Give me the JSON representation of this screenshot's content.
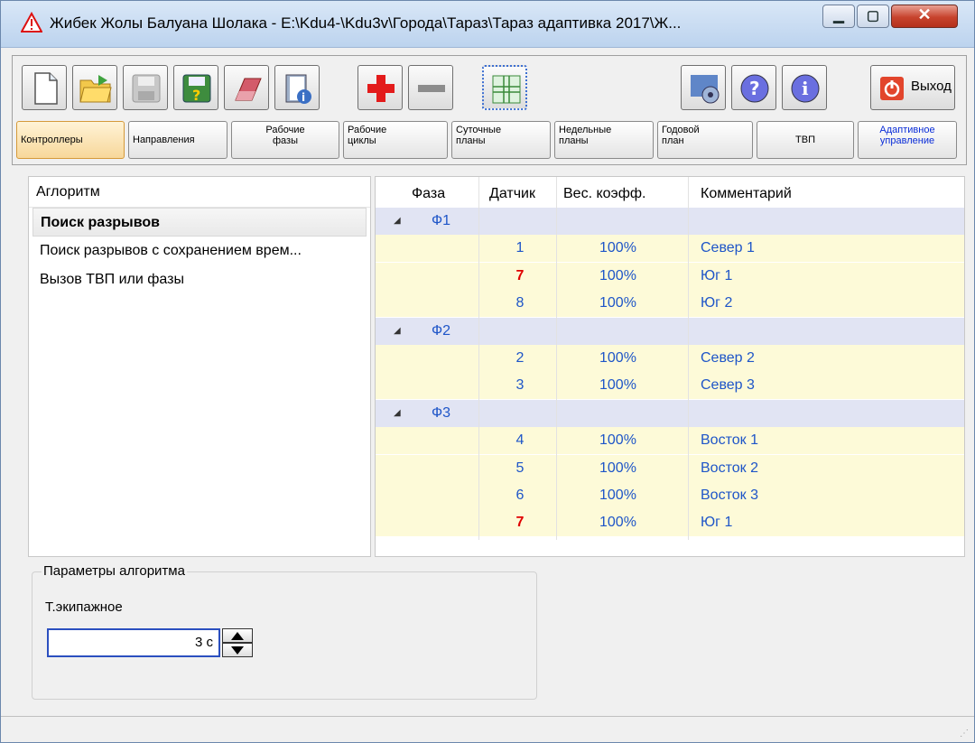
{
  "window": {
    "title": "Жибек Жолы Балуана Шолака - E:\\Kdu4-\\Kdu3v\\Города\\Тараз\\Тараз адаптивка 2017\\Ж..."
  },
  "toolbar": {
    "exit_label": "Выход"
  },
  "nav": [
    {
      "l1": "Контроллеры",
      "l2": ""
    },
    {
      "l1": "Направления",
      "l2": ""
    },
    {
      "l1": "Рабочие",
      "l2": "фазы"
    },
    {
      "l1": "Рабочие",
      "l2": "циклы"
    },
    {
      "l1": "Суточные",
      "l2": "планы"
    },
    {
      "l1": "Недельные",
      "l2": "планы"
    },
    {
      "l1": "Годовой",
      "l2": "план"
    },
    {
      "l1": "ТВП",
      "l2": ""
    },
    {
      "l1": "Адаптивное",
      "l2": "управление"
    }
  ],
  "algorithms": {
    "header": "Аглоритм",
    "items": [
      "Поиск разрывов",
      "Поиск разрывов с сохранением врем...",
      "Вызов ТВП или фазы"
    ]
  },
  "grid": {
    "headers": {
      "phase": "Фаза",
      "sensor": "Датчик",
      "weight": "Вес. коэфф.",
      "comment": "Комментарий"
    },
    "rows": [
      {
        "type": "group",
        "phase": "Ф1"
      },
      {
        "type": "data",
        "sensor": "1",
        "red": false,
        "weight": "100%",
        "comment": "Север 1"
      },
      {
        "type": "data",
        "sensor": "7",
        "red": true,
        "weight": "100%",
        "comment": "Юг 1"
      },
      {
        "type": "data",
        "sensor": "8",
        "red": false,
        "weight": "100%",
        "comment": "Юг 2"
      },
      {
        "type": "group",
        "phase": "Ф2"
      },
      {
        "type": "data",
        "sensor": "2",
        "red": false,
        "weight": "100%",
        "comment": "Север 2"
      },
      {
        "type": "data",
        "sensor": "3",
        "red": false,
        "weight": "100%",
        "comment": "Север 3"
      },
      {
        "type": "group",
        "phase": "Ф3"
      },
      {
        "type": "data",
        "sensor": "4",
        "red": false,
        "weight": "100%",
        "comment": "Восток 1"
      },
      {
        "type": "data",
        "sensor": "5",
        "red": false,
        "weight": "100%",
        "comment": "Восток 2"
      },
      {
        "type": "data",
        "sensor": "6",
        "red": false,
        "weight": "100%",
        "comment": "Восток 3"
      },
      {
        "type": "data",
        "sensor": "7",
        "red": true,
        "weight": "100%",
        "comment": "Юг 1"
      }
    ]
  },
  "params": {
    "title": "Параметры алгоритма",
    "label": "Т.экипажное",
    "value": "3 с"
  },
  "colors": {
    "accent_blue": "#1e55c8",
    "red_sensor": "#e00000",
    "group_row": "#e1e4f3",
    "data_row": "#fdfad8"
  }
}
